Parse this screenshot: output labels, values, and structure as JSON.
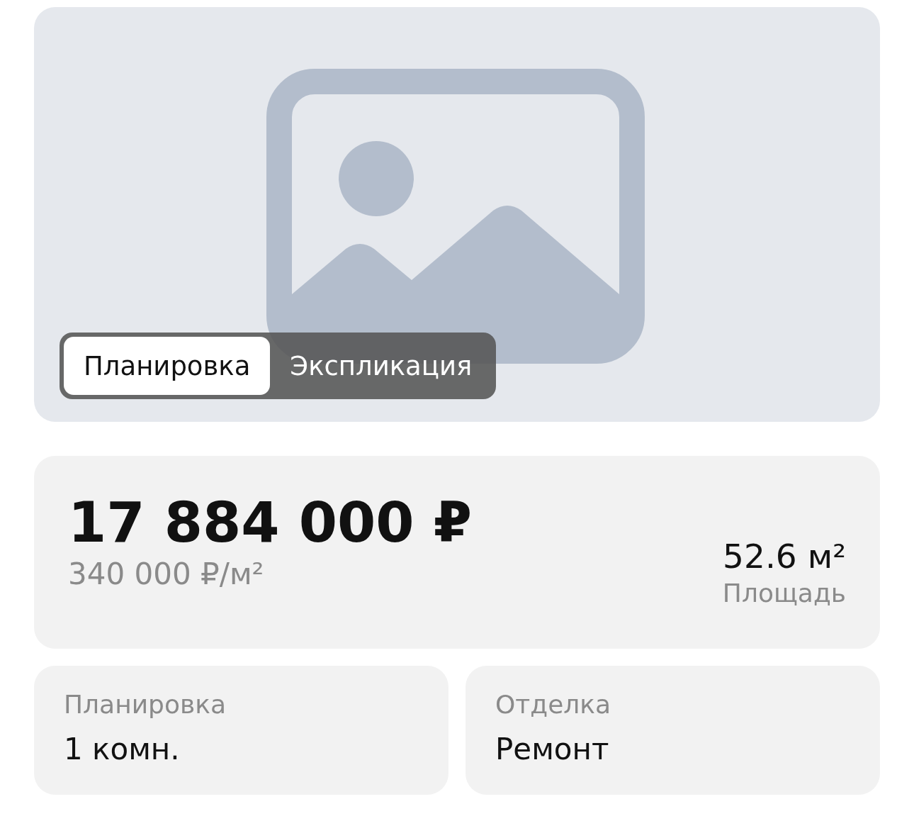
{
  "gallery": {
    "tabs": [
      {
        "label": "Планировка",
        "selected": true
      },
      {
        "label": "Экспликация",
        "selected": false
      }
    ]
  },
  "price": {
    "total": "17 884 000 ₽",
    "per_meter": "340 000 ₽/м²",
    "area": "52.6 м²",
    "area_label": "Площадь"
  },
  "facts": [
    {
      "label": "Планировка",
      "value": "1 комн."
    },
    {
      "label": "Отделка",
      "value": "Ремонт"
    }
  ]
}
